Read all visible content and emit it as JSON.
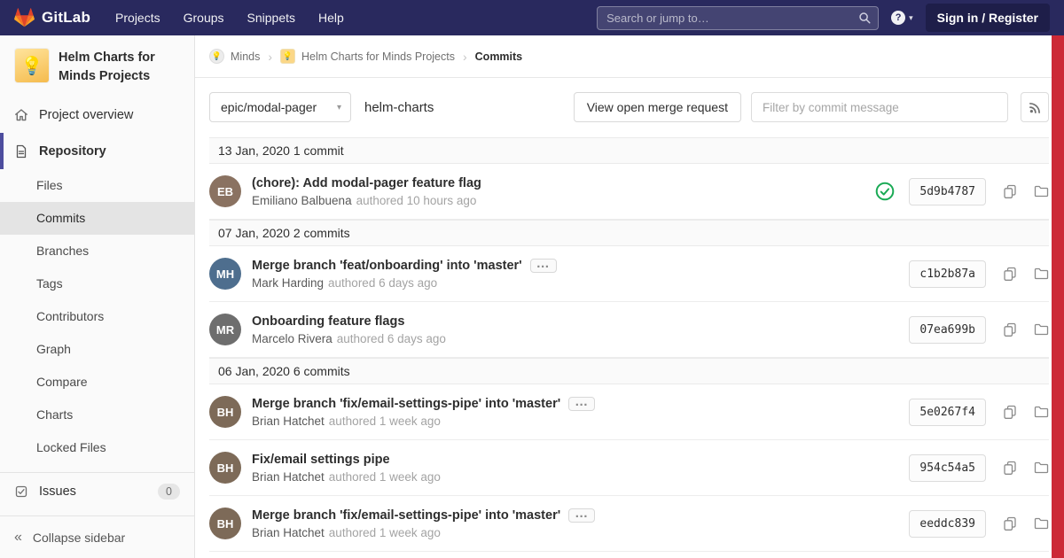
{
  "navbar": {
    "brand": "GitLab",
    "links": [
      "Projects",
      "Groups",
      "Snippets",
      "Help"
    ],
    "search_placeholder": "Search or jump to…",
    "sign_in_label": "Sign in / Register"
  },
  "icons": {
    "caret": "▾",
    "help": "?",
    "separator": "›",
    "collapse": "«",
    "ellipsis": "…",
    "bulb": "💡"
  },
  "sidebar": {
    "project_title": "Helm Charts for Minds Projects",
    "overview_label": "Project overview",
    "repository_label": "Repository",
    "repo_subitems": [
      "Files",
      "Commits",
      "Branches",
      "Tags",
      "Contributors",
      "Graph",
      "Compare",
      "Charts",
      "Locked Files"
    ],
    "issues_label": "Issues",
    "issues_count": "0",
    "collapse_label": "Collapse sidebar"
  },
  "breadcrumb": {
    "group": "Minds",
    "project": "Helm Charts for Minds Projects",
    "page": "Commits"
  },
  "controls": {
    "branch": "epic/modal-pager",
    "repo_name": "helm-charts",
    "mr_button": "View open merge request",
    "filter_placeholder": "Filter by commit message"
  },
  "commits": {
    "groups": [
      {
        "date": "13 Jan, 2020 1 commit",
        "items": [
          {
            "title": "(chore): Add modal-pager feature flag",
            "author": "Emiliano Balbuena",
            "time": "authored 10 hours ago",
            "sha": "5d9b4787",
            "initials": "EB"
          }
        ]
      },
      {
        "date": "07 Jan, 2020 2 commits",
        "items": [
          {
            "title": "Merge branch 'feat/onboarding' into 'master'",
            "author": "Mark Harding",
            "time": "authored 6 days ago",
            "sha": "c1b2b87a",
            "initials": "MH"
          },
          {
            "title": "Onboarding feature flags",
            "author": "Marcelo Rivera",
            "time": "authored 6 days ago",
            "sha": "07ea699b",
            "initials": "MR"
          }
        ]
      },
      {
        "date": "06 Jan, 2020 6 commits",
        "items": [
          {
            "title": "Merge branch 'fix/email-settings-pipe' into 'master'",
            "author": "Brian Hatchet",
            "time": "authored 1 week ago",
            "sha": "5e0267f4",
            "initials": "BH"
          },
          {
            "title": "Fix/email settings pipe",
            "author": "Brian Hatchet",
            "time": "authored 1 week ago",
            "sha": "954c54a5",
            "initials": "BH"
          },
          {
            "title": "Merge branch 'fix/email-settings-pipe' into 'master'",
            "author": "Brian Hatchet",
            "time": "authored 1 week ago",
            "sha": "eeddc839",
            "initials": "BH"
          }
        ]
      }
    ]
  },
  "colors": {
    "navbar_bg": "#29295e",
    "accent": "#4d4d9e",
    "success": "#1aaa55",
    "scrollbar_red": "#cc2936",
    "avatar_yellow": "#f5bb4d"
  }
}
